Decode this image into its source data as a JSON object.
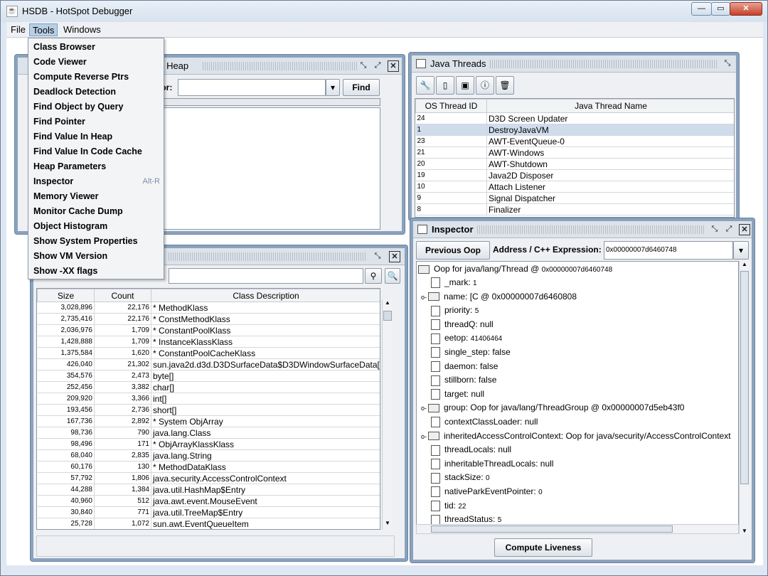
{
  "window": {
    "title": "HSDB - HotSpot Debugger",
    "app_icon": "java-icon"
  },
  "menubar": {
    "items": [
      "File",
      "Tools",
      "Windows"
    ]
  },
  "tools_menu": {
    "items": [
      {
        "label": "Class Browser",
        "shortcut": ""
      },
      {
        "label": "Code Viewer",
        "shortcut": ""
      },
      {
        "label": "Compute Reverse Ptrs",
        "shortcut": ""
      },
      {
        "label": "Deadlock Detection",
        "shortcut": ""
      },
      {
        "label": "Find Object by Query",
        "shortcut": ""
      },
      {
        "label": "Find Pointer",
        "shortcut": ""
      },
      {
        "label": "Find Value In Heap",
        "shortcut": ""
      },
      {
        "label": "Find Value In Code Cache",
        "shortcut": ""
      },
      {
        "label": "Heap Parameters",
        "shortcut": ""
      },
      {
        "label": "Inspector",
        "shortcut": "Alt-R"
      },
      {
        "label": "Memory Viewer",
        "shortcut": ""
      },
      {
        "label": "Monitor Cache Dump",
        "shortcut": ""
      },
      {
        "label": "Object Histogram",
        "shortcut": ""
      },
      {
        "label": "Show System Properties",
        "shortcut": ""
      },
      {
        "label": "Show VM Version",
        "shortcut": ""
      },
      {
        "label": "Show -XX flags",
        "shortcut": ""
      }
    ]
  },
  "find_in_heap": {
    "title": "ss In Heap",
    "search_label": "ch for:",
    "search_value": "",
    "find_button": "Find",
    "status_label": "s:"
  },
  "histogram": {
    "columns": [
      "Size",
      "Count",
      "Class Description"
    ],
    "rows": [
      [
        "3,028,896",
        "22,176",
        "* MethodKlass"
      ],
      [
        "2,735,416",
        "22,176",
        "* ConstMethodKlass"
      ],
      [
        "2,036,976",
        "1,709",
        "* ConstantPoolKlass"
      ],
      [
        "1,428,888",
        "1,709",
        "* InstanceKlassKlass"
      ],
      [
        "1,375,584",
        "1,620",
        "* ConstantPoolCacheKlass"
      ],
      [
        "426,040",
        "21,302",
        "sun.java2d.d3d.D3DSurfaceData$D3DWindowSurfaceData[]"
      ],
      [
        "354,576",
        "2,473",
        "byte[]"
      ],
      [
        "252,456",
        "3,382",
        "char[]"
      ],
      [
        "209,920",
        "3,366",
        "int[]"
      ],
      [
        "193,456",
        "2,736",
        "short[]"
      ],
      [
        "167,736",
        "2,892",
        "* System ObjArray"
      ],
      [
        "98,736",
        "790",
        "java.lang.Class"
      ],
      [
        "98,496",
        "171",
        "* ObjArrayKlassKlass"
      ],
      [
        "68,040",
        "2,835",
        "java.lang.String"
      ],
      [
        "60,176",
        "130",
        "* MethodDataKlass"
      ],
      [
        "57,792",
        "1,806",
        "java.security.AccessControlContext"
      ],
      [
        "44,288",
        "1,384",
        "java.util.HashMap$Entry"
      ],
      [
        "40,960",
        "512",
        "java.awt.event.MouseEvent"
      ],
      [
        "30,840",
        "771",
        "java.util.TreeMap$Entry"
      ],
      [
        "25,728",
        "1,072",
        "sun.awt.EventQueueItem"
      ]
    ]
  },
  "java_threads": {
    "title": "Java Threads",
    "columns": [
      "OS Thread ID",
      "Java Thread Name"
    ],
    "rows": [
      [
        "24",
        "D3D Screen Updater"
      ],
      [
        "1",
        "DestroyJavaVM"
      ],
      [
        "23",
        "AWT-EventQueue-0"
      ],
      [
        "21",
        "AWT-Windows"
      ],
      [
        "20",
        "AWT-Shutdown"
      ],
      [
        "19",
        "Java2D Disposer"
      ],
      [
        "10",
        "Attach Listener"
      ],
      [
        "9",
        "Signal Dispatcher"
      ],
      [
        "8",
        "Finalizer"
      ]
    ],
    "selected_index": 1
  },
  "inspector": {
    "title": "Inspector",
    "previous_button": "Previous Oop",
    "address_label": "Address / C++ Expression:",
    "address_value": "0x00000007d6460748",
    "compute_button": "Compute Liveness",
    "root": {
      "label": "Oop for java/lang/Thread @ ",
      "addr": "0x00000007d6460748"
    },
    "fields": [
      {
        "name": "_mark:",
        "value": "1",
        "kind": "leaf"
      },
      {
        "name": "name:",
        "value": "[C @ 0x00000007d6460808",
        "kind": "folder"
      },
      {
        "name": "priority:",
        "value": "5",
        "kind": "leaf"
      },
      {
        "name": "threadQ:",
        "value": "null",
        "kind": "leaf"
      },
      {
        "name": "eetop:",
        "value": "41406464",
        "kind": "leaf"
      },
      {
        "name": "single_step:",
        "value": "false",
        "kind": "leaf"
      },
      {
        "name": "daemon:",
        "value": "false",
        "kind": "leaf"
      },
      {
        "name": "stillborn:",
        "value": "false",
        "kind": "leaf"
      },
      {
        "name": "target:",
        "value": "null",
        "kind": "leaf"
      },
      {
        "name": "group:",
        "value": "Oop for java/lang/ThreadGroup @ 0x00000007d5eb43f0",
        "kind": "folder"
      },
      {
        "name": "contextClassLoader:",
        "value": "null",
        "kind": "leaf"
      },
      {
        "name": "inheritedAccessControlContext:",
        "value": "Oop for java/security/AccessControlContext",
        "kind": "folder"
      },
      {
        "name": "threadLocals:",
        "value": "null",
        "kind": "leaf"
      },
      {
        "name": "inheritableThreadLocals:",
        "value": "null",
        "kind": "leaf"
      },
      {
        "name": "stackSize:",
        "value": "0",
        "kind": "leaf"
      },
      {
        "name": "nativeParkEventPointer:",
        "value": "0",
        "kind": "leaf"
      },
      {
        "name": "tid:",
        "value": "22",
        "kind": "leaf"
      },
      {
        "name": "threadStatus:",
        "value": "5",
        "kind": "leaf"
      }
    ]
  },
  "colors": {
    "selection": "#cfdcec",
    "frame_border": "#8aa2bd",
    "accent": "#7d8fa8"
  }
}
